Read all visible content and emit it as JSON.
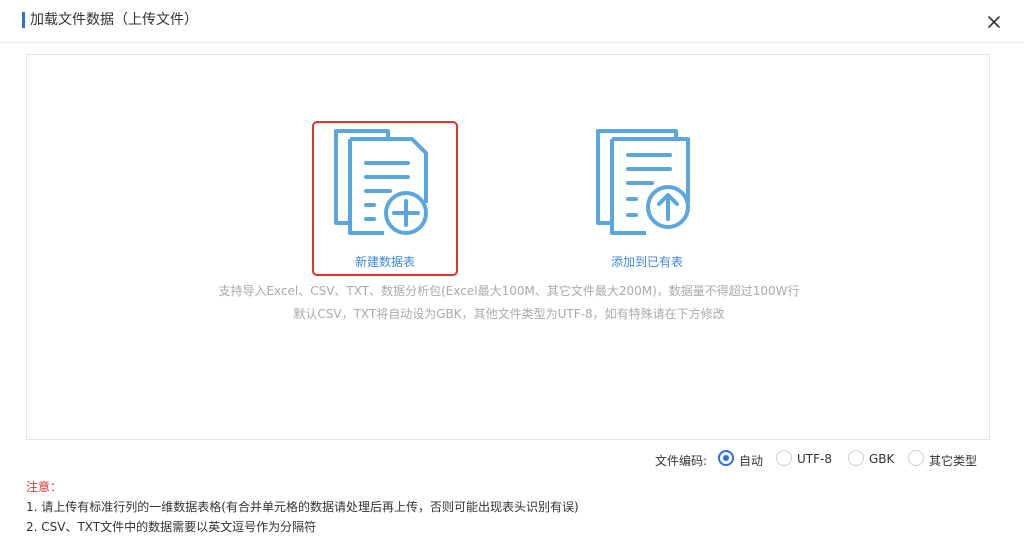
{
  "dialog": {
    "title": "加载文件数据（上传文件）",
    "close_icon": "close-icon"
  },
  "upload": {
    "options": [
      {
        "label": "新建数据表",
        "icon": "new-table-icon",
        "selected": true
      },
      {
        "label": "添加到已有表",
        "icon": "upload-to-existing-icon",
        "selected": false
      }
    ],
    "hint_line1": "支持导入Excel、CSV、TXT、数据分析包(Excel最大100M、其它文件最大200M)，数据量不得超过100W行",
    "hint_line2": "默认CSV，TXT将自动设为GBK，其他文件类型为UTF-8，如有特殊请在下方修改"
  },
  "encoding": {
    "label": "文件编码:",
    "options": [
      {
        "label": "自动",
        "checked": true
      },
      {
        "label": "UTF-8",
        "checked": false
      },
      {
        "label": "GBK",
        "checked": false
      },
      {
        "label": "其它类型",
        "checked": false
      }
    ]
  },
  "notes": {
    "title": "注意：",
    "items": [
      "1. 请上传有标准行列的一维数据表格(有合并单元格的数据请处理后再上传，否则可能出现表头识别有误)",
      "2. CSV、TXT文件中的数据需要以英文逗号作为分隔符"
    ]
  },
  "colors": {
    "accent": "#2f6fd6",
    "icon_blue": "#5aa7df",
    "label_blue": "#3d8ad6",
    "selection_red": "#e0342a"
  }
}
